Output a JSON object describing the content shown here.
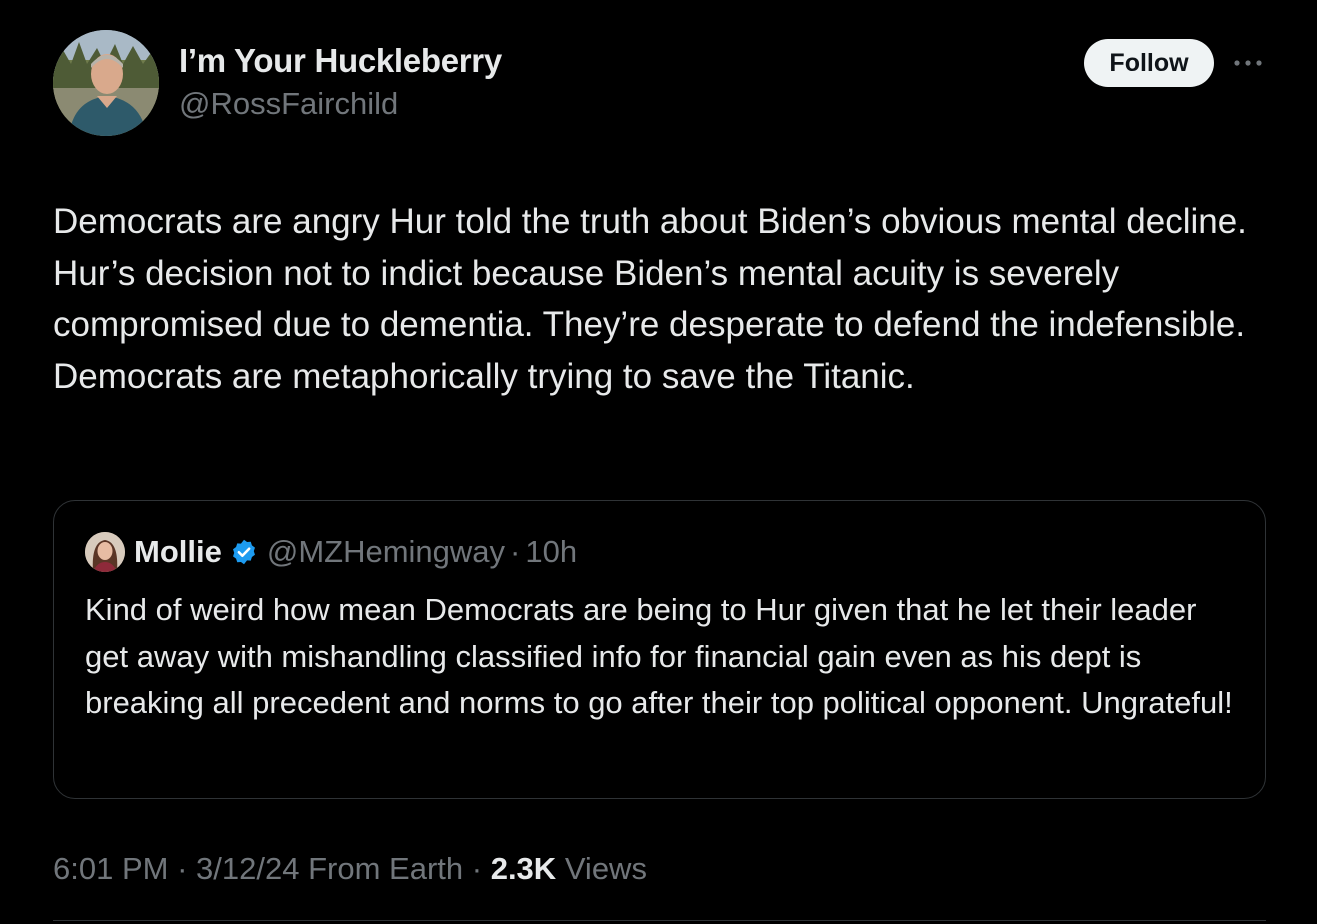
{
  "author": {
    "display_name": "I’m Your Huckleberry",
    "handle": "@RossFairchild"
  },
  "actions": {
    "follow_label": "Follow",
    "more_icon": "more-horizontal-icon"
  },
  "tweet": {
    "text": "Democrats are angry Hur told the truth about Biden’s obvious mental decline. Hur’s decision not to indict because Biden’s mental acuity is severely compromised due to dementia. They’re desperate to defend the indefensible. Democrats are metaphorically trying to save the Titanic."
  },
  "quote": {
    "name": "Mollie",
    "verified_icon": "verified-badge-icon",
    "handle": "@MZHemingway",
    "separator": "·",
    "time": "10h",
    "text": "Kind of weird how mean Democrats are being to Hur given that he let their leader get away with mishandling classified info for financial gain even as his dept is breaking all precedent and norms to go after their top political opponent. Ungrateful!"
  },
  "meta": {
    "time": "6:01 PM",
    "sep1": "·",
    "date": "3/12/24",
    "source": "From Earth",
    "sep2": "·",
    "views_count": "2.3K",
    "views_label": "Views"
  },
  "colors": {
    "background": "#000000",
    "text": "#e7e9ea",
    "secondary": "#71767b",
    "border": "#2f3336",
    "verified": "#1d9bf0",
    "follow_bg": "#eff3f4"
  }
}
